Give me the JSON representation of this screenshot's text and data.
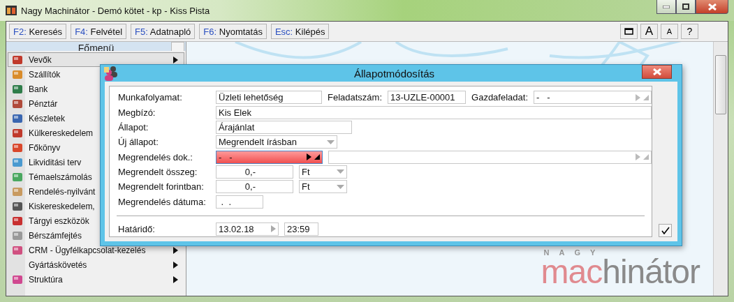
{
  "window": {
    "title": "Nagy Machinátor - Demó kötet - kp - Kiss Pista"
  },
  "toolbar": {
    "buttons": [
      {
        "key": "F2:",
        "label": "Keresés"
      },
      {
        "key": "F4:",
        "label": "Felvétel"
      },
      {
        "key": "F5:",
        "label": "Adatnapló"
      },
      {
        "key": "F6:",
        "label": "Nyomtatás"
      },
      {
        "key": "Esc:",
        "label": "Kilépés"
      }
    ],
    "font_buttons": [
      "A",
      "A"
    ],
    "help_button": "?"
  },
  "sidebar": {
    "title": "Főmenü",
    "items": [
      {
        "label": "Vevők",
        "selected": true,
        "submenu": true,
        "icon": true
      },
      {
        "label": "Szállítók",
        "selected": false,
        "submenu": false,
        "icon": true
      },
      {
        "label": "Bank",
        "selected": false,
        "submenu": false,
        "icon": true
      },
      {
        "label": "Pénztár",
        "selected": false,
        "submenu": false,
        "icon": true
      },
      {
        "label": "Készletek",
        "selected": false,
        "submenu": false,
        "icon": true
      },
      {
        "label": "Külkereskedelem",
        "selected": false,
        "submenu": false,
        "icon": true
      },
      {
        "label": "Főkönyv",
        "selected": false,
        "submenu": false,
        "icon": true
      },
      {
        "label": "Likviditási terv",
        "selected": false,
        "submenu": false,
        "icon": true
      },
      {
        "label": "Témaelszámolás",
        "selected": false,
        "submenu": false,
        "icon": true
      },
      {
        "label": "Rendelés-nyilvánt",
        "selected": false,
        "submenu": false,
        "icon": true
      },
      {
        "label": "Kiskereskedelem,",
        "selected": false,
        "submenu": false,
        "icon": true
      },
      {
        "label": "Tárgyi eszközök",
        "selected": false,
        "submenu": false,
        "icon": true
      },
      {
        "label": "Bérszámfejtés",
        "selected": false,
        "submenu": false,
        "icon": true
      },
      {
        "label": "CRM - Ügyfélkapcsolat-kezelés",
        "selected": false,
        "submenu": true,
        "icon": true
      },
      {
        "label": "Gyártáskövetés",
        "selected": false,
        "submenu": true,
        "icon": false
      },
      {
        "label": "Struktúra",
        "selected": false,
        "submenu": true,
        "icon": true
      }
    ]
  },
  "logo": {
    "top": "NAGY",
    "accent": "mac",
    "rest": "hinátor"
  },
  "dialog": {
    "title": "Állapotmódosítás",
    "rows": [
      {
        "label": "Munkafolyamat:",
        "fields": [
          {
            "kind": "text",
            "value": "Üzleti lehetőség"
          },
          {
            "kind": "label",
            "value": "Feladatszám:"
          },
          {
            "kind": "text",
            "value": "13-UZLE-00001"
          },
          {
            "kind": "label",
            "value": "Gazdafeladat:"
          },
          {
            "kind": "lookup",
            "value": "-   -",
            "invalid": false
          }
        ]
      },
      {
        "label": "Megbízó:",
        "fields": [
          {
            "kind": "text",
            "value": "Kis Elek"
          }
        ]
      },
      {
        "label": "Állapot:",
        "fields": [
          {
            "kind": "text",
            "value": "Árajánlat"
          }
        ]
      },
      {
        "label": "Új állapot:",
        "fields": [
          {
            "kind": "combo",
            "value": "Megrendelt írásban"
          }
        ]
      },
      {
        "label": "Megrendelés dok.:",
        "fields": [
          {
            "kind": "lookup",
            "value": "-   -",
            "invalid": true
          },
          {
            "kind": "lookup",
            "invalid": false
          }
        ]
      },
      {
        "label": "Megrendelt összeg:",
        "fields": [
          {
            "kind": "amount",
            "value": "0,-"
          },
          {
            "kind": "combo",
            "value": "Ft"
          }
        ]
      },
      {
        "label": "Megrendelt forintban:",
        "fields": [
          {
            "kind": "amount",
            "value": "0,-"
          },
          {
            "kind": "combo",
            "value": "Ft"
          }
        ]
      },
      {
        "label": "Megrendelés dátuma:",
        "fields": [
          {
            "kind": "text",
            "value": " .  ."
          }
        ]
      }
    ],
    "deadline": {
      "label": "Határidő:",
      "fields": [
        {
          "kind": "date",
          "value": "13.02.18"
        },
        {
          "kind": "text",
          "value": "23:59"
        }
      ]
    }
  }
}
